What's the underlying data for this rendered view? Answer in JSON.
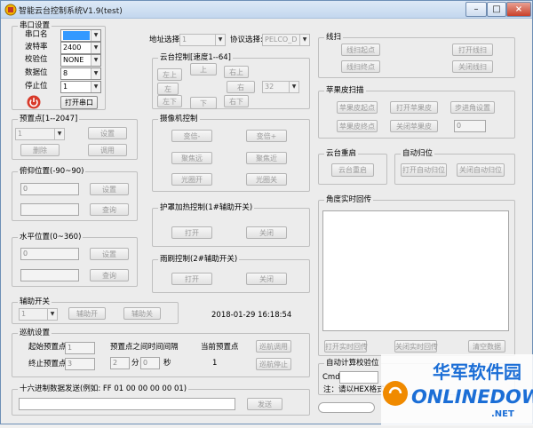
{
  "title": "智能云台控制系统V1.9(test)",
  "window_controls": {
    "minimize": "–",
    "maximize": "□",
    "close": "×"
  },
  "serial": {
    "group": "串口设置",
    "port_label": "串口名",
    "baud_label": "波特率",
    "baud": "2400",
    "parity_label": "校验位",
    "parity": "NONE",
    "databits_label": "数据位",
    "databits": "8",
    "stopbits_label": "停止位",
    "stopbits": "1",
    "open_button": "打开串口"
  },
  "address": {
    "label": "地址选择:",
    "value": "1"
  },
  "protocol": {
    "label": "协议选择:",
    "value": "PELCO_D"
  },
  "ptz": {
    "group": "云台控制[速度1--64]",
    "upleft": "左上",
    "up": "上",
    "upright": "右上",
    "left": "左",
    "right": "右",
    "downleft": "左下",
    "down": "下",
    "downright": "右下",
    "speed": "32"
  },
  "camera": {
    "group": "摄像机控制",
    "zoom_out": "变倍-",
    "zoom_in": "变倍+",
    "focus_far": "聚焦远",
    "focus_near": "聚焦近",
    "iris_open": "光圈开",
    "iris_close": "光圈关"
  },
  "heater": {
    "group": "护罩加热控制(1#辅助开关)",
    "on": "打开",
    "off": "关闭"
  },
  "wiper": {
    "group": "雨刷控制(2#辅助开关)",
    "on": "打开",
    "off": "关闭"
  },
  "preset": {
    "group": "预置点[1--2047]",
    "value": "1",
    "set": "设置",
    "delete": "删除",
    "call": "调用"
  },
  "tilt": {
    "group": "俯仰位置(-90~90)",
    "value": "0",
    "set": "设置",
    "query": "查询"
  },
  "pan": {
    "group": "水平位置(0~360)",
    "value": "0",
    "set": "设置",
    "query": "查询"
  },
  "aux": {
    "group": "辅助开关",
    "value": "1",
    "on": "辅助开",
    "off": "辅助关"
  },
  "datetime": "2018-01-29 16:18:54",
  "cruise": {
    "group": "巡航设置",
    "start_label": "起始预置点",
    "start": "1",
    "end_label": "终止预置点",
    "end": "3",
    "interval_label": "预置点之间时间间隔",
    "minutes": "2",
    "min_unit": "分",
    "seconds": "0",
    "sec_unit": "秒",
    "current_label": "当前预置点",
    "current": "1",
    "call": "巡航调用",
    "stop": "巡航停止"
  },
  "hex": {
    "group": "十六进制数据发送(例如: FF 01 00 00 00 00 01)",
    "send": "发送"
  },
  "line_scan": {
    "group": "线扫",
    "start": "线扫起点",
    "end": "线扫终点",
    "open": "打开线扫",
    "close": "关闭线扫"
  },
  "apple_scan": {
    "group": "苹果皮扫描",
    "start": "苹果皮起点",
    "open": "打开苹果皮",
    "step_label": "步进角设置",
    "end": "苹果皮终点",
    "close": "关闭苹果皮",
    "step": "0"
  },
  "restart": {
    "group": "云台重启",
    "button": "云台重启"
  },
  "auto_home": {
    "group": "自动归位",
    "open": "打开自动归位",
    "close": "关闭自动归位"
  },
  "angle": {
    "group": "角度实时回传",
    "open": "打开实时回传",
    "close": "关闭实时回传",
    "clear": "清空数据"
  },
  "autocheck": {
    "group": "自动计算校验位",
    "cmd_label": "Cmd1:",
    "note": "注：请以HEX格式"
  },
  "watermark": {
    "line1": "华军软件园",
    "line2": "ONLINEDOWN",
    "line3": ".NET"
  },
  "colors": {
    "accent": "#1a5fb4",
    "logo_blue": "#1b6ed6",
    "logo_orange": "#f08a00",
    "selected": "#3399ff"
  }
}
